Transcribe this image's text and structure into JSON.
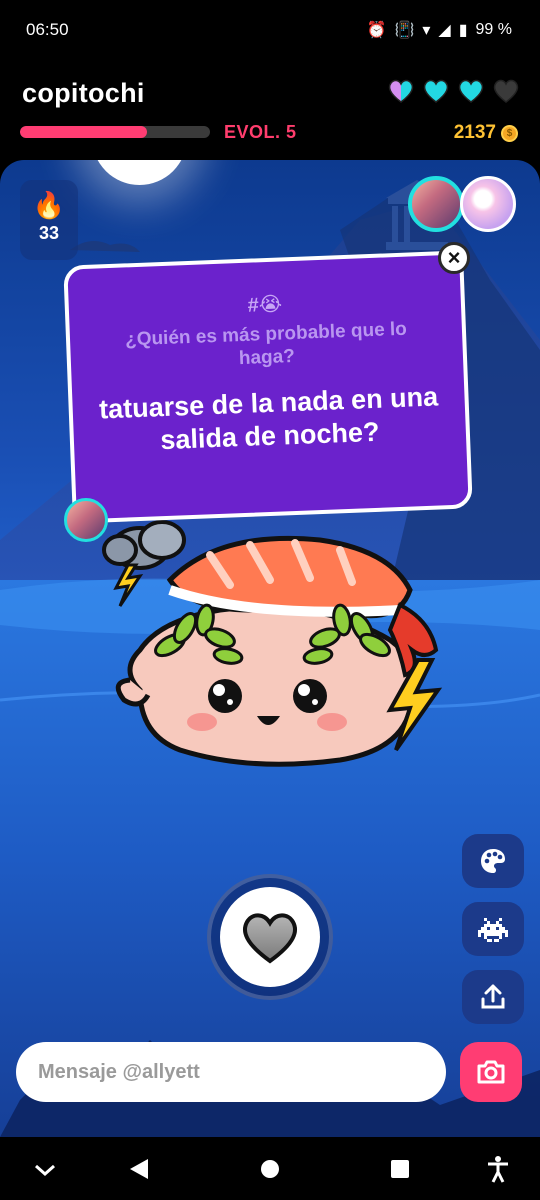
{
  "status_bar": {
    "time": "06:50",
    "battery": "99 %"
  },
  "header": {
    "username": "copitochi",
    "evolution_label": "EVOL. 5",
    "evolution_progress": 0.67,
    "coins": "2137",
    "hearts": [
      {
        "state": "purple-cyan",
        "color": "#d48ef0"
      },
      {
        "state": "full",
        "color": "#23d8e3"
      },
      {
        "state": "full",
        "color": "#23d8e3"
      },
      {
        "state": "empty",
        "color": "#3a3a3a"
      }
    ]
  },
  "streak": {
    "count": "33",
    "icon": "flame-icon"
  },
  "question": {
    "tag": "#😭",
    "subtitle": "¿Quién es más probable que lo haga?",
    "text": "tatuarse de la nada en una salida de noche?"
  },
  "message": {
    "placeholder": "Mensaje @allyett"
  },
  "tools": [
    "palette-icon",
    "space-invader-icon",
    "share-icon"
  ],
  "colors": {
    "accent": "#ff3d73",
    "card": "#6b22cc",
    "coin": "#ffc233",
    "heart_cyan": "#23d8e3"
  }
}
